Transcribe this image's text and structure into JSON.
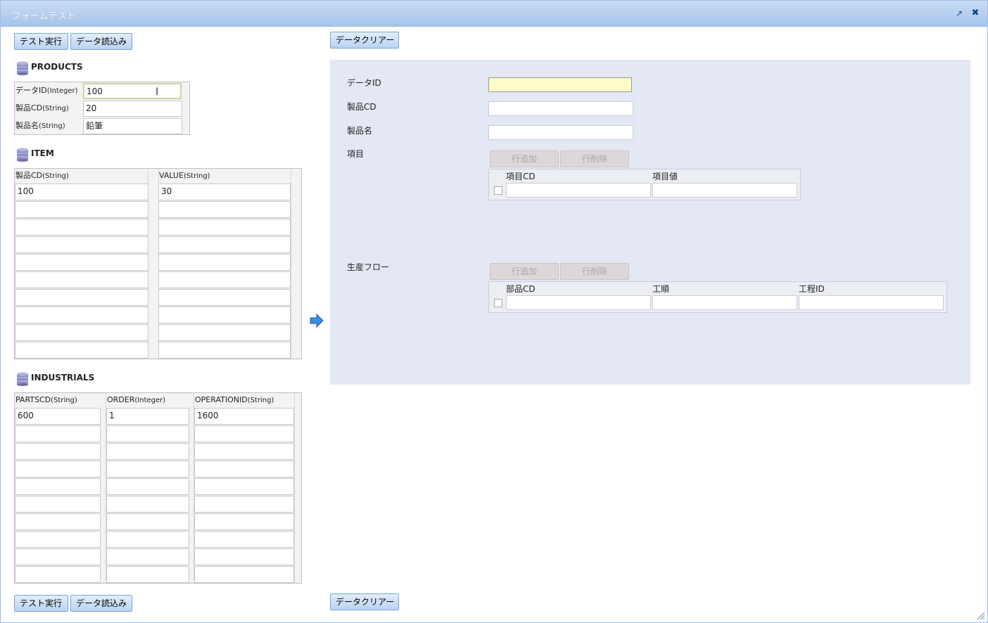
{
  "window": {
    "title": "フォームテスト",
    "popout_icon": "popout-icon",
    "close_icon": "close-icon"
  },
  "buttons": {
    "run": "テスト実行",
    "load": "データ読込み",
    "clear": "データクリアー"
  },
  "products": {
    "title": "PRODUCTS",
    "fields": [
      {
        "label": "データID",
        "type": "(Integer)",
        "value": "100"
      },
      {
        "label": "製品CD",
        "type": "(String)",
        "value": "20"
      },
      {
        "label": "製品名",
        "type": "(String)",
        "value": "鉛筆"
      }
    ]
  },
  "item": {
    "title": "ITEM",
    "columns": [
      {
        "label": "製品CD",
        "type": "(String)"
      },
      {
        "label": "VALUE",
        "type": "(String)"
      }
    ],
    "rows": [
      [
        "100",
        "30"
      ],
      [
        "",
        ""
      ],
      [
        "",
        ""
      ],
      [
        "",
        ""
      ],
      [
        "",
        ""
      ],
      [
        "",
        ""
      ],
      [
        "",
        ""
      ],
      [
        "",
        ""
      ],
      [
        "",
        ""
      ],
      [
        "",
        ""
      ]
    ]
  },
  "industrials": {
    "title": "INDUSTRIALS",
    "columns": [
      {
        "label": "PARTSCD",
        "type": "(String)"
      },
      {
        "label": "ORDER",
        "type": "(Integer)"
      },
      {
        "label": "OPERATIONID",
        "type": "(String)"
      }
    ],
    "rows": [
      [
        "600",
        "1",
        "1600"
      ],
      [
        "",
        "",
        ""
      ],
      [
        "",
        "",
        ""
      ],
      [
        "",
        "",
        ""
      ],
      [
        "",
        "",
        ""
      ],
      [
        "",
        "",
        ""
      ],
      [
        "",
        "",
        ""
      ],
      [
        "",
        "",
        ""
      ],
      [
        "",
        "",
        ""
      ],
      [
        "",
        "",
        ""
      ]
    ]
  },
  "form": {
    "data_id_label": "データID",
    "product_cd_label": "製品CD",
    "product_name_label": "製品名",
    "items_label": "項目",
    "flow_label": "生産フロー",
    "add_row": "行追加",
    "delete_row": "行削除",
    "items_columns": [
      "項目CD",
      "項目値"
    ],
    "flow_columns": [
      "部品CD",
      "工順",
      "工程ID"
    ]
  }
}
